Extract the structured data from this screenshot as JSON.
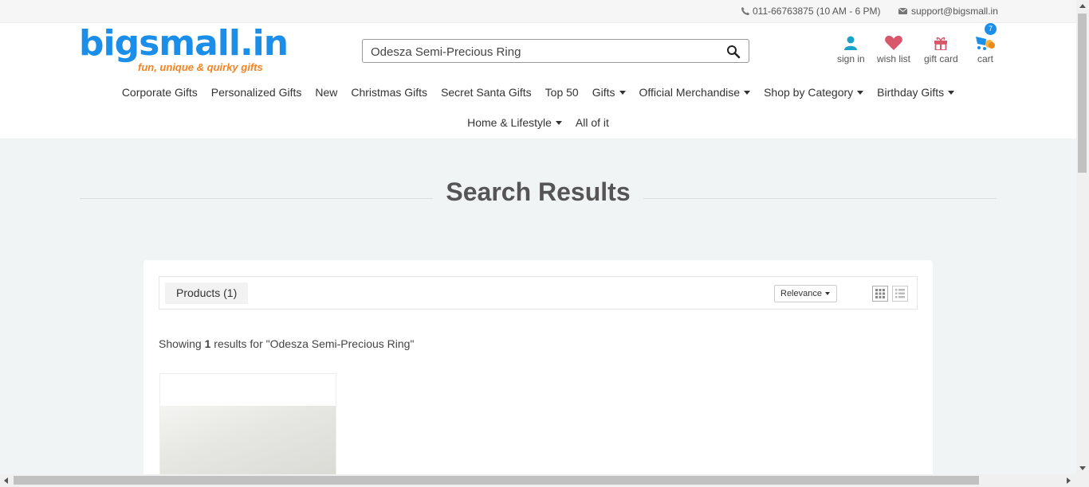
{
  "topbar": {
    "phone": "011-66763875 (10 AM - 6 PM)",
    "email": "support@bigsmall.in"
  },
  "logo": {
    "name": "bigsmall.in",
    "tagline": "fun, unique & quirky gifts"
  },
  "search": {
    "value": "Odesza Semi-Precious Ring"
  },
  "actions": {
    "signin": "sign in",
    "wishlist": "wish list",
    "giftcard": "gift card",
    "cart": "cart",
    "cart_count": "7"
  },
  "nav": {
    "corporate": "Corporate Gifts",
    "personalized": "Personalized Gifts",
    "new": "New",
    "christmas": "Christmas Gifts",
    "secret_santa": "Secret Santa Gifts",
    "top50": "Top 50",
    "gifts": "Gifts",
    "merch": "Official Merchandise",
    "shop_category": "Shop by Category",
    "birthday": "Birthday Gifts",
    "home_lifestyle": "Home & Lifestyle",
    "all": "All of it"
  },
  "page": {
    "title": "Search Results"
  },
  "results": {
    "tab": "Products (1)",
    "sort": "Relevance",
    "showing_prefix": "Showing ",
    "count": "1",
    "showing_suffix": " results for \"Odesza Semi-Precious Ring\""
  },
  "colors": {
    "brand_blue": "#1a8ee8",
    "brand_orange": "#f5821f"
  }
}
